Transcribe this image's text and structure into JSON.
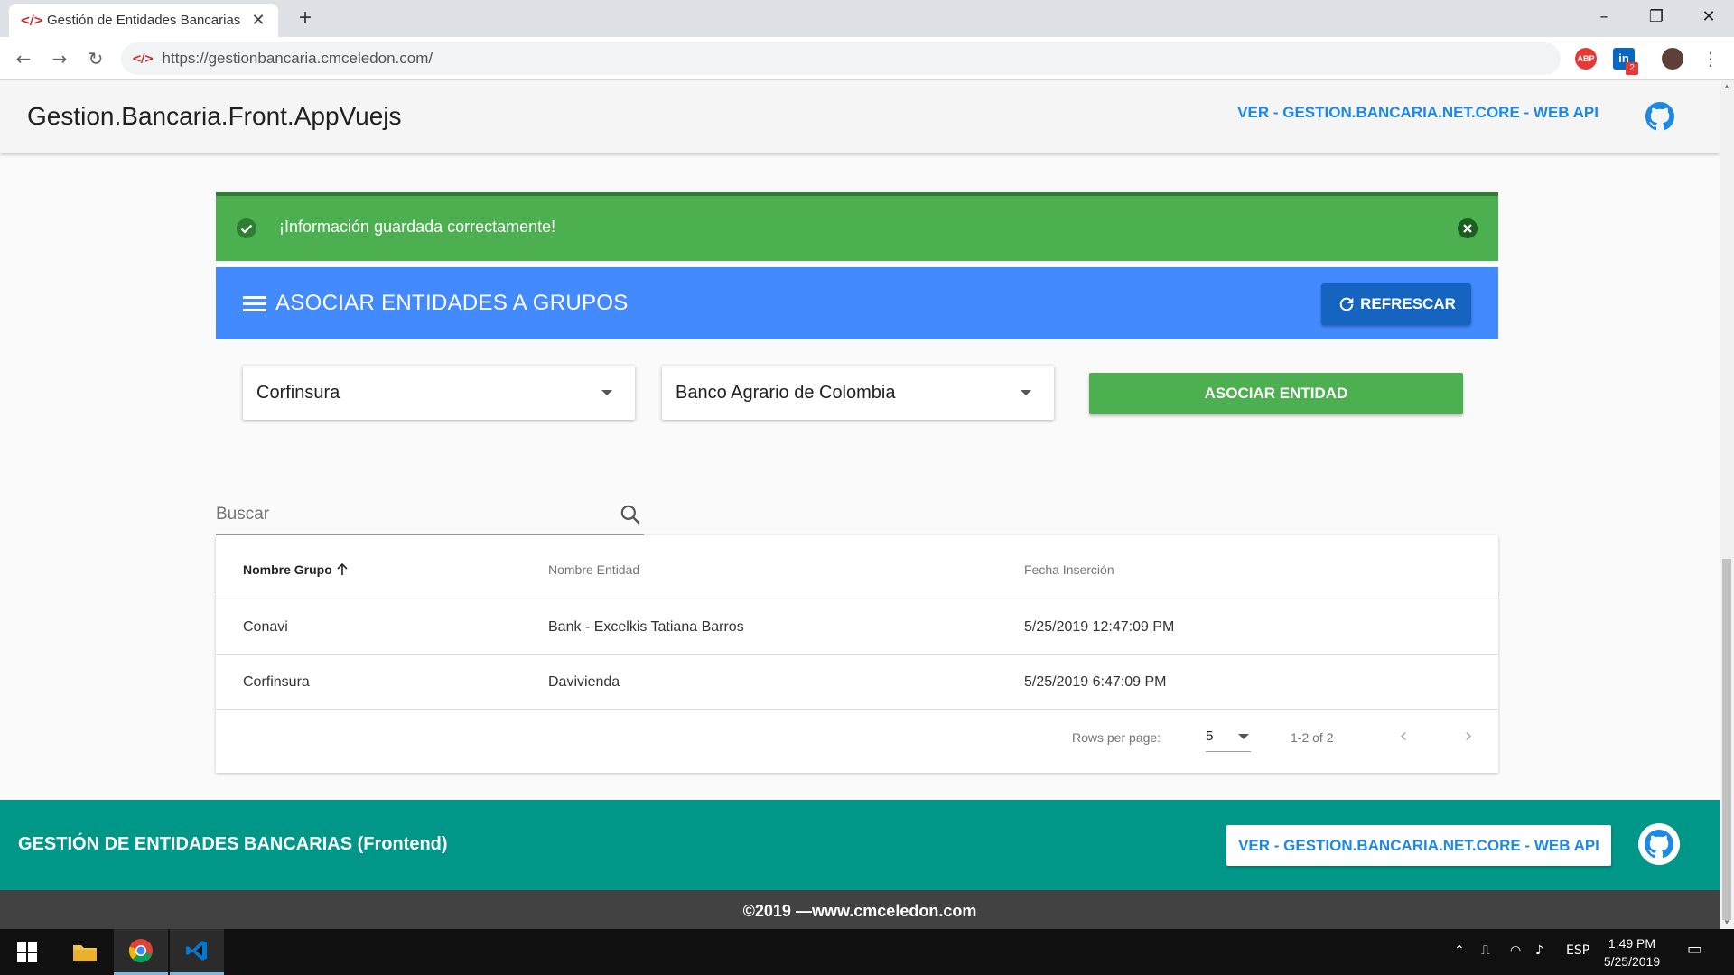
{
  "browser": {
    "tab_title": "Gestión de Entidades Bancarias",
    "tab_favicon": "</>",
    "url": "https://gestionbancaria.cmceledon.com/",
    "omnibox_favicon": "</>",
    "extensions": {
      "adblock_label": "ABP",
      "badge_count": "2"
    }
  },
  "appbar": {
    "title": "Gestion.Bancaria.Front.AppVuejs",
    "api_link": "VER - GESTION.BANCARIA.NET.CORE - WEB API"
  },
  "alert": {
    "message": "¡Información guardada correctamente!",
    "color": "#4caf50"
  },
  "section": {
    "title": "ASOCIAR ENTIDADES A GRUPOS",
    "refresh_label": "REFRESCAR",
    "color": "#448aff"
  },
  "form": {
    "group_select": "Corfinsura",
    "entity_select": "Banco Agrario de Colombia",
    "associate_label": "ASOCIAR ENTIDAD"
  },
  "search": {
    "placeholder": "Buscar"
  },
  "table": {
    "headers": [
      "Nombre Grupo",
      "Nombre Entidad",
      "Fecha Inserción"
    ],
    "sort_icon": "arrow-up-icon",
    "rows": [
      [
        "Conavi",
        "Bank - Excelkis Tatiana Barros",
        "5/25/2019 12:47:09 PM"
      ],
      [
        "Corfinsura",
        "Davivienda",
        "5/25/2019 6:47:09 PM"
      ]
    ],
    "rows_per_page_label": "Rows per page:",
    "rows_per_page": "5",
    "range": "1-2 of 2"
  },
  "footer": {
    "title": "GESTIÓN DE ENTIDADES BANCARIAS (Frontend)",
    "api_button": "VER - GESTION.BANCARIA.NET.CORE - WEB API",
    "copyright": "©2019 —www.cmceledon.com",
    "teal": "#009688"
  },
  "taskbar": {
    "language": "ESP",
    "time": "1:49 PM",
    "date": "5/25/2019"
  }
}
